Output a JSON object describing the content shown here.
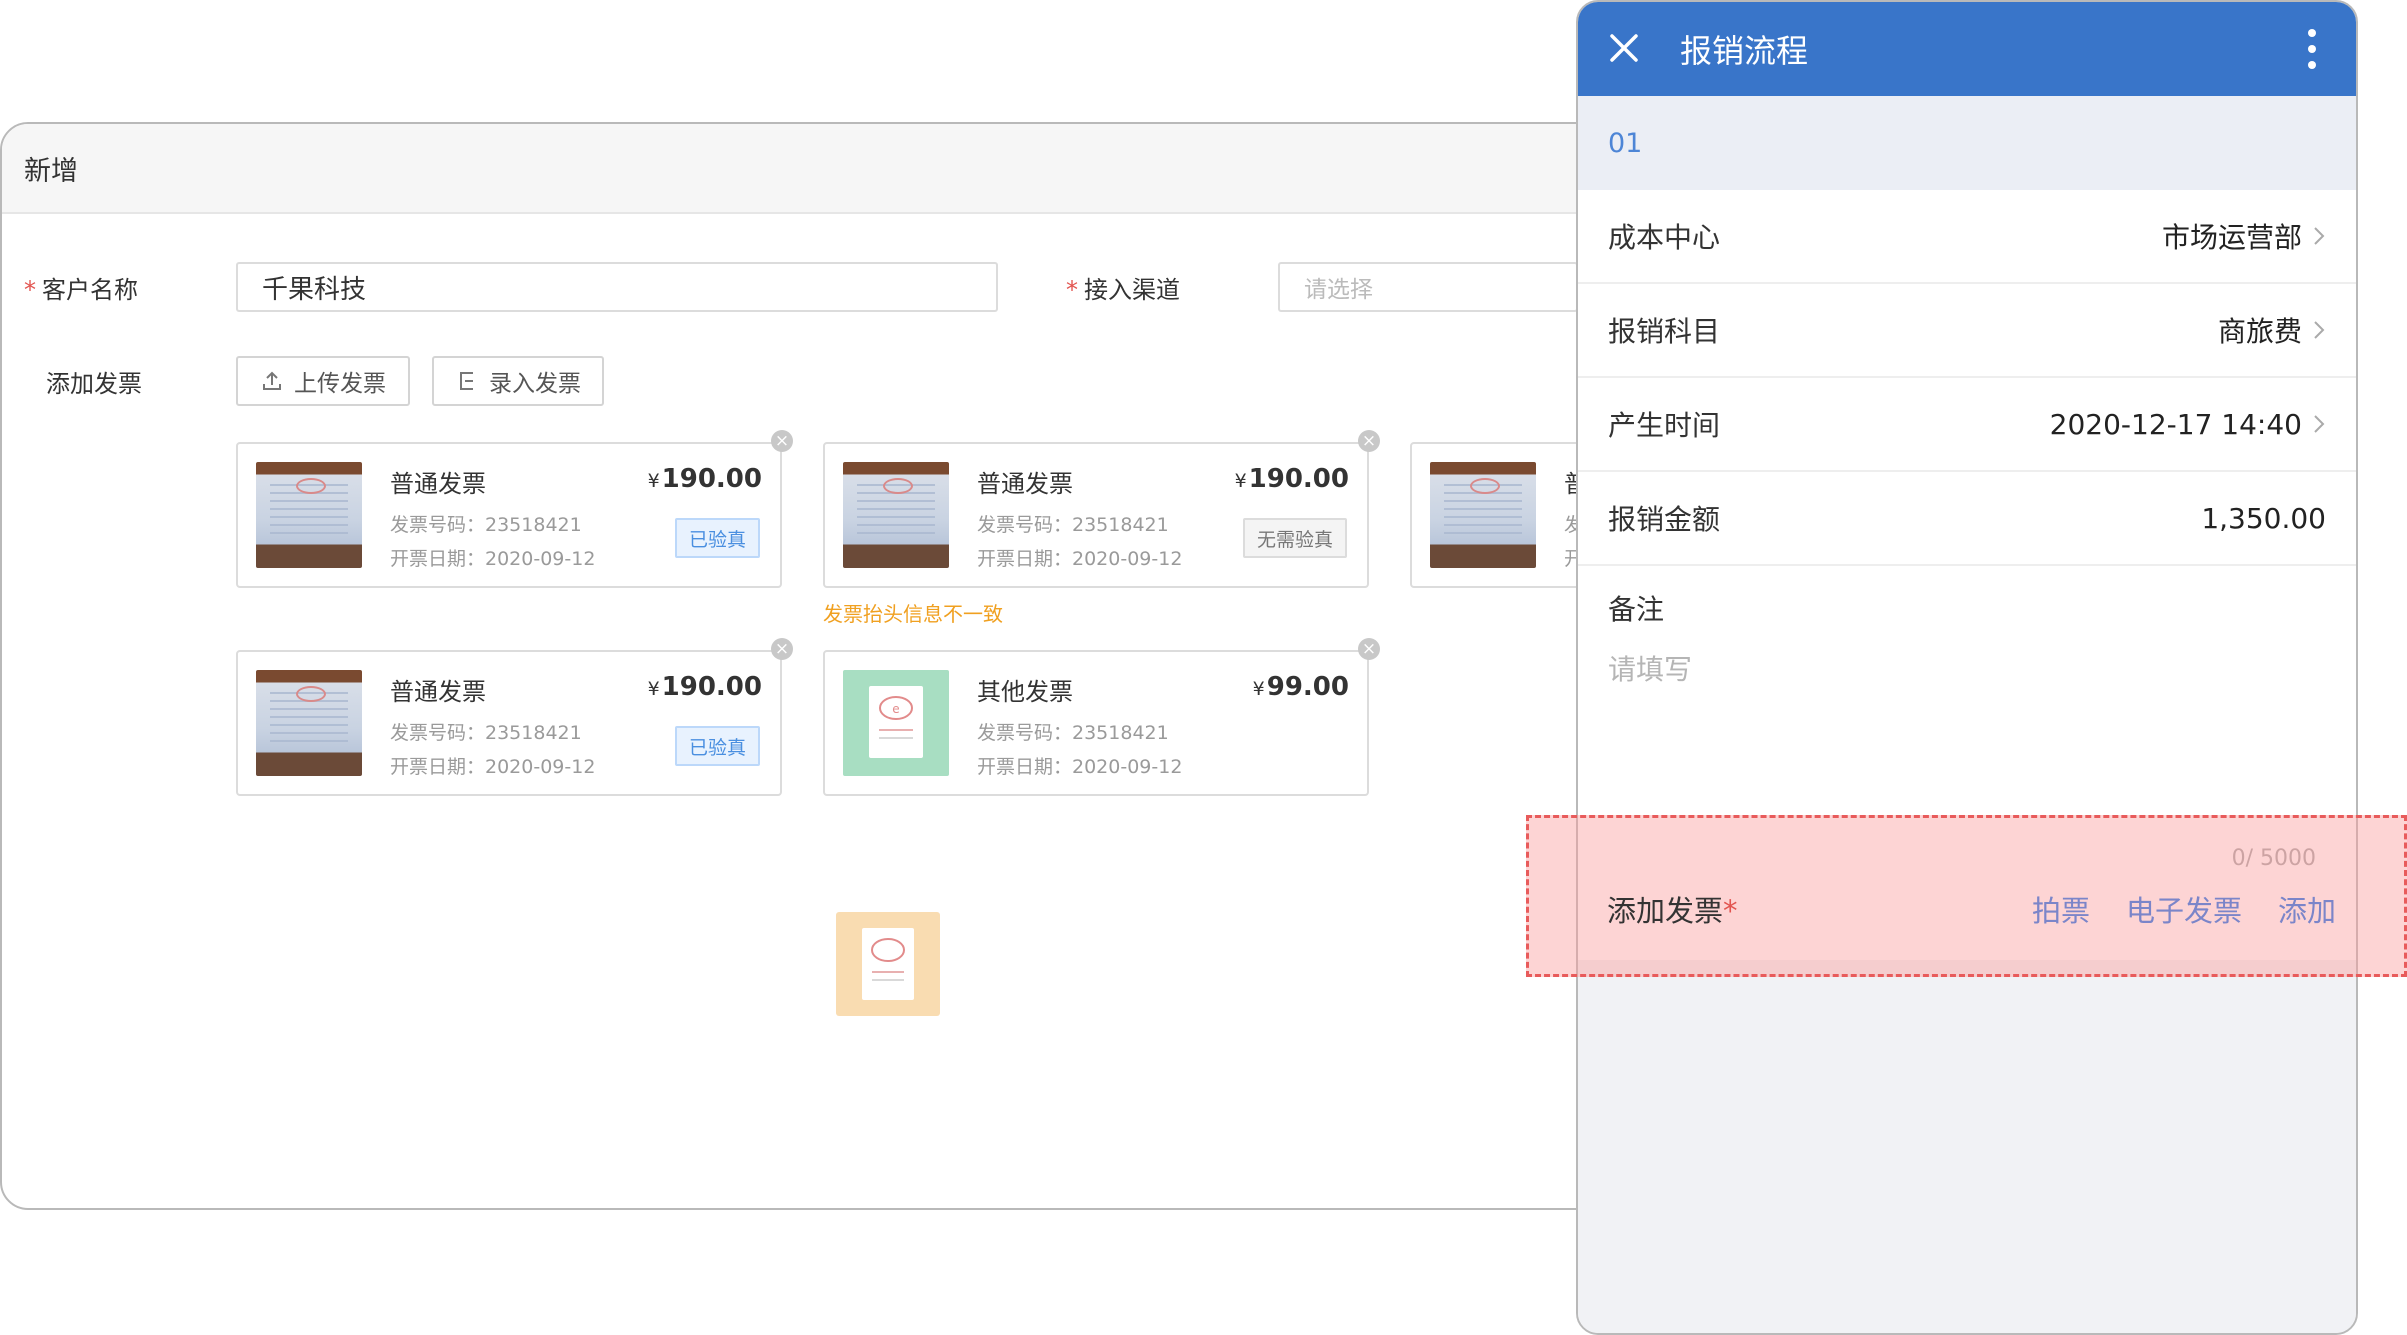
{
  "form": {
    "title": "新增",
    "customer_label": "客户名称",
    "customer_value": "千果科技",
    "channel_label": "接入渠道",
    "channel_placeholder": "请选择",
    "add_invoice_label": "添加发票",
    "upload_button": "上传发票",
    "entry_button": "录入发票",
    "cards": [
      {
        "title": "普通发票",
        "amount": "190.00",
        "currency": "¥",
        "code_line": "发票号码：23518421",
        "date_line": "开票日期：2020-09-12",
        "tag": "已验真",
        "thumb": "invoice-photo"
      },
      {
        "title": "普通发票",
        "amount": "190.00",
        "currency": "¥",
        "code_line": "发票号码：23518421",
        "date_line": "开票日期：2020-09-12",
        "tag": "无需验真",
        "thumb": "invoice-photo"
      },
      {
        "title": "普",
        "code_line": "发",
        "date_line": "开",
        "thumb": "invoice-photo"
      },
      {
        "title": "普通发票",
        "amount": "190.00",
        "currency": "¥",
        "code_line": "发票号码：23518421",
        "date_line": "开票日期：2020-09-12",
        "tag": "已验真",
        "thumb": "invoice-photo"
      },
      {
        "title": "其他发票",
        "amount": "99.00",
        "currency": "¥",
        "code_line": "发票号码：23518421",
        "date_line": "开票日期：2020-09-12",
        "thumb": "receipt-icon"
      }
    ],
    "warning": "发票抬头信息不一致",
    "colors": {
      "accent": "#4a8fe0",
      "warning": "#f0a020",
      "required": "#e2544f"
    }
  },
  "phone": {
    "title": "报销流程",
    "code": "01",
    "rows": [
      {
        "label": "成本中心",
        "value": "市场运营部",
        "chevron": true
      },
      {
        "label": "报销科目",
        "value": "商旅费",
        "chevron": true
      },
      {
        "label": "产生时间",
        "value": "2020-12-17 14:40",
        "chevron": true
      },
      {
        "label": "报销金额",
        "value": "1,350.00",
        "chevron": false
      }
    ],
    "remark_label": "备注",
    "remark_placeholder": "请填写",
    "remark_count": "0/ 5000",
    "add_invoice_label": "添加发票",
    "add_invoice_required": "*",
    "actions": [
      "拍票",
      "电子发票",
      "添加"
    ],
    "colors": {
      "topbar": "#3975c9",
      "action": "#7b85c9"
    }
  }
}
